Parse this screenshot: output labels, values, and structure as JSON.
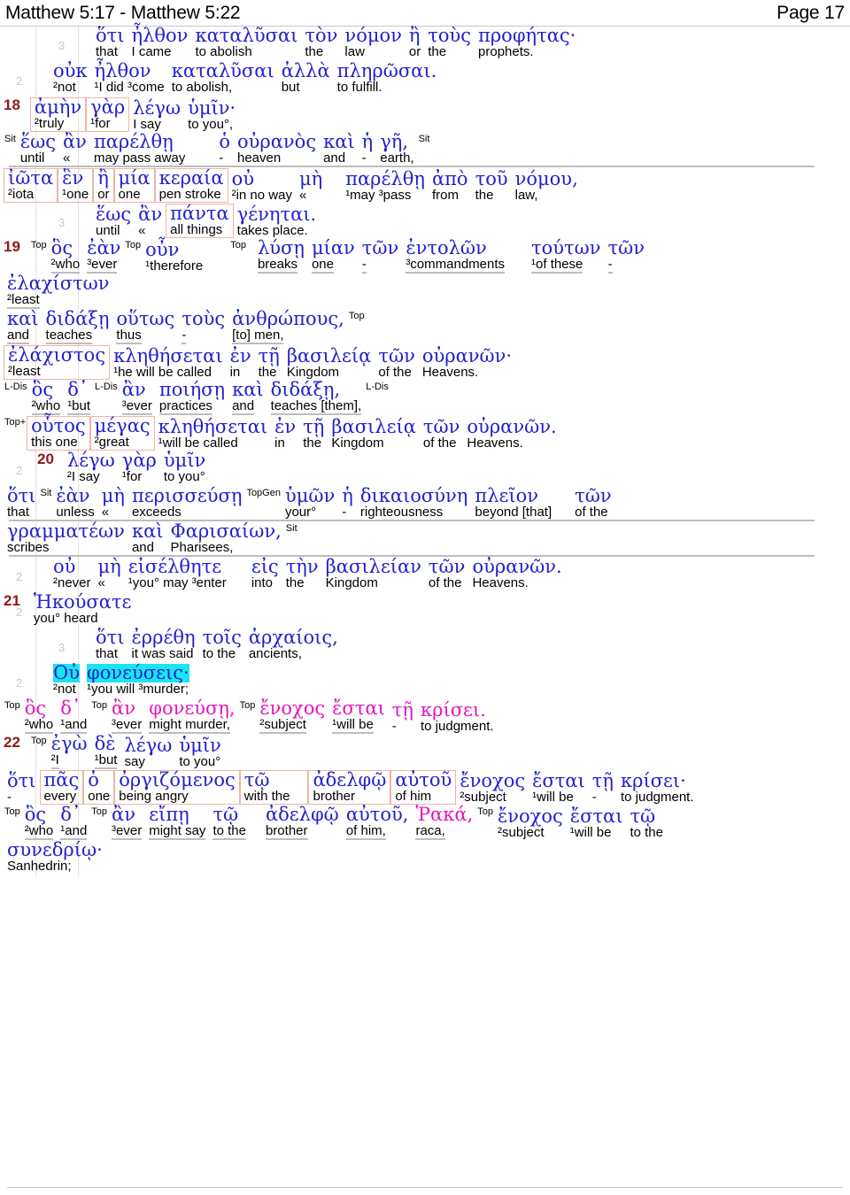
{
  "header": {
    "reference_range": "Matthew 5:17 - Matthew 5:22",
    "page_label": "Page 17"
  },
  "colors": {
    "greek": "#2222cc",
    "greek_alt": "#e515c0",
    "english": "#000000",
    "verse_number": "#8b1a1a",
    "highlight": "#1ae5f0",
    "box_border": "#edb5a8",
    "guide_line": "#e3e3e3",
    "underline": "#bdbdbd",
    "level_digit": "#c9c9c9"
  },
  "tags": {
    "sit": "Sit",
    "top": "Top",
    "top_plus": "Top+",
    "top_gen": "TopGen",
    "l_dis": "L-Dis"
  },
  "lines": [
    {
      "id": "l1",
      "level": "3",
      "indent": 110,
      "words": [
        {
          "gk": "ὅτι",
          "en": "that"
        },
        {
          "gk": "ἦλθον",
          "en": "I came"
        },
        {
          "gk": "καταλῦσαι",
          "en": "to abolish"
        },
        {
          "gk": "τὸν",
          "en": "the"
        },
        {
          "gk": "νόμον",
          "en": "law"
        },
        {
          "gk": "ἢ",
          "en": "or"
        },
        {
          "gk": "τοὺς",
          "en": "the"
        },
        {
          "gk": "προφήτας·",
          "en": "prophets."
        }
      ]
    },
    {
      "id": "l2",
      "level": "2",
      "indent": 62,
      "words": [
        {
          "gk": "οὐκ",
          "en": "²not"
        },
        {
          "gk": "ἦλθον",
          "en": "¹I did ³come"
        },
        {
          "gk": "καταλῦσαι",
          "en": "to abolish,"
        },
        {
          "gk": "ἀλλὰ",
          "en": "but"
        },
        {
          "gk": "πληρῶσαι.",
          "en": "to fulfill."
        }
      ]
    },
    {
      "id": "l3",
      "verse": "18",
      "indent": 62,
      "box_from": 0,
      "box_to": 1,
      "words": [
        {
          "gk": "ἀμὴν",
          "en": "²truly"
        },
        {
          "gk": "γὰρ",
          "en": "¹for"
        },
        {
          "gk": "λέγω",
          "en": "I say"
        },
        {
          "gk": "ὑμῖν·",
          "en": "to you°,"
        }
      ]
    },
    {
      "id": "l4",
      "indent": 10,
      "lead_tag": "Sit",
      "underline": true,
      "words": [
        {
          "gk": "ἕως",
          "en": "until"
        },
        {
          "gk": "ἂν",
          "en": "«"
        },
        {
          "gk": "παρέλθῃ",
          "en": "may pass away",
          "pad": 34
        },
        {
          "gk": "ὁ",
          "en": "-"
        },
        {
          "gk": "οὐρανὸς",
          "en": "heaven"
        },
        {
          "gk": "καὶ",
          "en": "and"
        },
        {
          "gk": "ἡ",
          "en": "-"
        },
        {
          "gk": "γῆ,",
          "en": "earth,",
          "tag_after": "Sit"
        }
      ]
    },
    {
      "id": "l5",
      "indent": 10,
      "box_from": 0,
      "box_to": 4,
      "words": [
        {
          "gk": "ἰῶτα",
          "en": "²iota"
        },
        {
          "gk": "ἓν",
          "en": "¹one"
        },
        {
          "gk": "ἢ",
          "en": "or"
        },
        {
          "gk": "μία",
          "en": "one"
        },
        {
          "gk": "κεραία",
          "en": "pen stroke"
        },
        {
          "gk": "οὐ",
          "en": "²in no way"
        },
        {
          "gk": "μὴ",
          "en": "«",
          "pad": 22
        },
        {
          "gk": "παρέλθῃ",
          "en": "¹may ³pass"
        },
        {
          "gk": "ἀπὸ",
          "en": "from"
        },
        {
          "gk": "τοῦ",
          "en": "the"
        },
        {
          "gk": "νόμου,",
          "en": "law,"
        }
      ]
    },
    {
      "id": "l6",
      "level": "3",
      "indent": 110,
      "box_from": 2,
      "box_to": 2,
      "words": [
        {
          "gk": "ἕως",
          "en": "until"
        },
        {
          "gk": "ἂν",
          "en": "«"
        },
        {
          "gk": "πάντα",
          "en": "all things"
        },
        {
          "gk": "γένηται.",
          "en": "takes place."
        }
      ]
    },
    {
      "id": "l7",
      "verse": "19",
      "indent": 62,
      "lead_tag": "Top",
      "words": [
        {
          "gk": "ὃς",
          "en": "²who",
          "ul": true
        },
        {
          "gk": "ἐὰν",
          "en": "³ever",
          "ul": true,
          "tag_after": "Top"
        },
        {
          "gk": "οὖν",
          "en": "¹therefore",
          "pad": 30
        },
        {
          "gk": "",
          "en": "",
          "tag_lead": "Top"
        },
        {
          "gk": "λύσῃ",
          "en": "breaks",
          "ul": true
        },
        {
          "gk": "μίαν",
          "en": "one",
          "ul": true
        },
        {
          "gk": "τῶν",
          "en": "-",
          "ul": true
        },
        {
          "gk": "ἐντολῶν",
          "en": "³commandments",
          "ul": true,
          "pad": 26
        },
        {
          "gk": "τούτων",
          "en": "¹of these",
          "ul": true
        },
        {
          "gk": "τῶν",
          "en": "-",
          "ul": true
        }
      ]
    },
    {
      "id": "l8",
      "indent": 10,
      "words": [
        {
          "gk": "ἐλαχίστων",
          "en": "²least",
          "ul": true
        }
      ]
    },
    {
      "id": "l9",
      "indent": 10,
      "words": [
        {
          "gk": "καὶ",
          "en": "and",
          "ul": true
        },
        {
          "gk": "διδάξῃ",
          "en": "teaches",
          "ul": true
        },
        {
          "gk": "οὕτως",
          "en": "thus",
          "ul": true
        },
        {
          "gk": "τοὺς",
          "en": "-",
          "ul": true
        },
        {
          "gk": "ἀνθρώπους,",
          "en": "[to] men,",
          "ul": true,
          "tag_after": "Top"
        }
      ]
    },
    {
      "id": "l10",
      "indent": 10,
      "box_from": 0,
      "box_to": 0,
      "words": [
        {
          "gk": "ἐλάχιστος",
          "en": "²least"
        },
        {
          "gk": "κληθήσεται",
          "en": "¹he will be called"
        },
        {
          "gk": "ἐν",
          "en": "in"
        },
        {
          "gk": "τῇ",
          "en": "the"
        },
        {
          "gk": "βασιλείᾳ",
          "en": "Kingdom"
        },
        {
          "gk": "τῶν",
          "en": "of the"
        },
        {
          "gk": "οὐρανῶν·",
          "en": "Heavens."
        }
      ]
    },
    {
      "id": "l11",
      "indent": 10,
      "lead_tag": "L-Dis",
      "words": [
        {
          "gk": "ὃς",
          "en": "²who",
          "ul": true
        },
        {
          "gk": "δ᾽",
          "en": "¹but",
          "ul": true,
          "tag_after": "L-Dis"
        },
        {
          "gk": "ἂν",
          "en": "³ever",
          "ul": true
        },
        {
          "gk": "ποιήσῃ",
          "en": "practices",
          "ul": true
        },
        {
          "gk": "καὶ",
          "en": "and",
          "ul": true
        },
        {
          "gk": "διδάξῃ,",
          "en": "teaches [them],",
          "ul": true,
          "tag_after": "L-Dis"
        }
      ]
    },
    {
      "id": "l12",
      "indent": 10,
      "lead_tag": "Top+",
      "box_from": -1,
      "box_to": 0,
      "box2_from": 1,
      "box2_to": 1,
      "words": [
        {
          "gk": "οὗτος",
          "en": "this one"
        },
        {
          "gk": "μέγας",
          "en": "²great"
        },
        {
          "gk": "κληθήσεται",
          "en": "¹will be called"
        },
        {
          "gk": "ἐν",
          "en": "in"
        },
        {
          "gk": "τῇ",
          "en": "the"
        },
        {
          "gk": "βασιλείᾳ",
          "en": "Kingdom"
        },
        {
          "gk": "τῶν",
          "en": "of the"
        },
        {
          "gk": "οὐρανῶν.",
          "en": "Heavens."
        }
      ]
    },
    {
      "id": "l13",
      "verse": "20",
      "level": "2",
      "indent": 100,
      "words": [
        {
          "gk": "λέγω",
          "en": "²I say"
        },
        {
          "gk": "γὰρ",
          "en": "¹for"
        },
        {
          "gk": "ὑμῖν",
          "en": "to you°"
        }
      ]
    },
    {
      "id": "l14",
      "indent": 10,
      "underline": true,
      "words": [
        {
          "gk": "ὅτι",
          "en": "that"
        },
        {
          "gk": "ἐὰν",
          "en": "unless",
          "tag_lead": "Sit"
        },
        {
          "gk": "μὴ",
          "en": "«"
        },
        {
          "gk": "περισσεύσῃ",
          "en": "exceeds"
        },
        {
          "gk": "ὑμῶν",
          "en": "your°",
          "tag_lead": "TopGen"
        },
        {
          "gk": "ἡ",
          "en": "-"
        },
        {
          "gk": "δικαιοσύνη",
          "en": "righteousness"
        },
        {
          "gk": "πλεῖον",
          "en": "beyond [that]",
          "pad": 22
        },
        {
          "gk": "τῶν",
          "en": "of the"
        }
      ]
    },
    {
      "id": "l15",
      "indent": 10,
      "underline": true,
      "words": [
        {
          "gk": "γραμματέων",
          "en": "scribes"
        },
        {
          "gk": "καὶ",
          "en": "and"
        },
        {
          "gk": "Φαρισαίων,",
          "en": "Pharisees,",
          "tag_after": "Sit"
        }
      ]
    },
    {
      "id": "l16",
      "level": "2",
      "indent": 62,
      "words": [
        {
          "gk": "οὐ",
          "en": "²never"
        },
        {
          "gk": "μὴ",
          "en": "«"
        },
        {
          "gk": "εἰσέλθητε",
          "en": "¹you° may ³enter",
          "pad": 24
        },
        {
          "gk": "εἰς",
          "en": "into"
        },
        {
          "gk": "τὴν",
          "en": "the"
        },
        {
          "gk": "βασιλείαν",
          "en": "Kingdom"
        },
        {
          "gk": "τῶν",
          "en": "of the"
        },
        {
          "gk": "οὐρανῶν.",
          "en": "Heavens."
        }
      ]
    },
    {
      "id": "l17",
      "verse": "21",
      "level": "2",
      "indent": 62,
      "words": [
        {
          "gk": "Ἠκούσατε",
          "en": "you° heard"
        }
      ]
    },
    {
      "id": "l18",
      "level": "3",
      "indent": 110,
      "words": [
        {
          "gk": "ὅτι",
          "en": "that"
        },
        {
          "gk": "ἐρρέθη",
          "en": "it was said"
        },
        {
          "gk": "τοῖς",
          "en": "to the"
        },
        {
          "gk": "ἀρχαίοις,",
          "en": "ancients,"
        }
      ]
    },
    {
      "id": "l19",
      "level": "2",
      "indent": 62,
      "words": [
        {
          "gk": "Οὐ",
          "en": "²not",
          "hl": true
        },
        {
          "gk": "φονεύσεις·",
          "en": "¹you will ³murder;",
          "hl": true
        }
      ]
    },
    {
      "id": "l20",
      "indent": 10,
      "lead_tag": "Top",
      "magenta": true,
      "words": [
        {
          "gk": "ὃς",
          "en": "²who",
          "ul": true
        },
        {
          "gk": "δ᾽",
          "en": "¹and",
          "ul": true,
          "tag_after": "Top"
        },
        {
          "gk": "ἂν",
          "en": "³ever",
          "ul": true
        },
        {
          "gk": "φονεύσῃ,",
          "en": "might murder,",
          "ul": true,
          "tag_after": "Top"
        },
        {
          "gk": "ἔνοχος",
          "en": "²subject",
          "ul": true
        },
        {
          "gk": "ἔσται",
          "en": "¹will be",
          "ul": true
        },
        {
          "gk": "τῇ",
          "en": "-"
        },
        {
          "gk": "κρίσει.",
          "en": "to judgment."
        }
      ]
    },
    {
      "id": "l21",
      "verse": "22",
      "indent": 62,
      "lead_tag": "Top",
      "words": [
        {
          "gk": "ἐγὼ",
          "en": "²I",
          "ul": true
        },
        {
          "gk": "δὲ",
          "en": "¹but",
          "ul": true
        },
        {
          "gk": "λέγω",
          "en": "say"
        },
        {
          "gk": "ὑμῖν",
          "en": "to you°"
        }
      ]
    },
    {
      "id": "l22",
      "indent": 10,
      "box_from": 1,
      "box_to": 6,
      "words": [
        {
          "gk": "ὅτι",
          "en": "-"
        },
        {
          "gk": "πᾶς",
          "en": "every"
        },
        {
          "gk": "ὁ",
          "en": "one"
        },
        {
          "gk": "ὀργιζόμενος",
          "en": "being angry"
        },
        {
          "gk": "τῷ",
          "en": "with the",
          "pad": 20
        },
        {
          "gk": "ἀδελφῷ",
          "en": "brother"
        },
        {
          "gk": "αὐτοῦ",
          "en": "of him"
        },
        {
          "gk": "ἔνοχος",
          "en": "²subject"
        },
        {
          "gk": "ἔσται",
          "en": "¹will be"
        },
        {
          "gk": "τῇ",
          "en": "-"
        },
        {
          "gk": "κρίσει·",
          "en": "to judgment."
        }
      ]
    },
    {
      "id": "l23",
      "indent": 10,
      "lead_tag": "Top",
      "words": [
        {
          "gk": "ὃς",
          "en": "²who",
          "ul": true
        },
        {
          "gk": "δ᾽",
          "en": "¹and",
          "ul": true,
          "tag_after": "Top"
        },
        {
          "gk": "ἂν",
          "en": "³ever",
          "ul": true
        },
        {
          "gk": "εἴπῃ",
          "en": "might say",
          "ul": true
        },
        {
          "gk": "τῷ",
          "en": "to the",
          "ul": true,
          "pad": 18
        },
        {
          "gk": "ἀδελφῷ",
          "en": "brother",
          "ul": true
        },
        {
          "gk": "αὐτοῦ,",
          "en": "of him,",
          "ul": true
        },
        {
          "gk": "Ῥακά,",
          "en": "raca,",
          "ul": true,
          "magenta": true,
          "tag_after": "Top"
        },
        {
          "gk": "ἔνοχος",
          "en": "²subject"
        },
        {
          "gk": "ἔσται",
          "en": "¹will be"
        },
        {
          "gk": "τῷ",
          "en": "to the"
        }
      ]
    },
    {
      "id": "l24",
      "indent": 10,
      "words": [
        {
          "gk": "συνεδρίῳ·",
          "en": "Sanhedrin;"
        }
      ]
    }
  ]
}
